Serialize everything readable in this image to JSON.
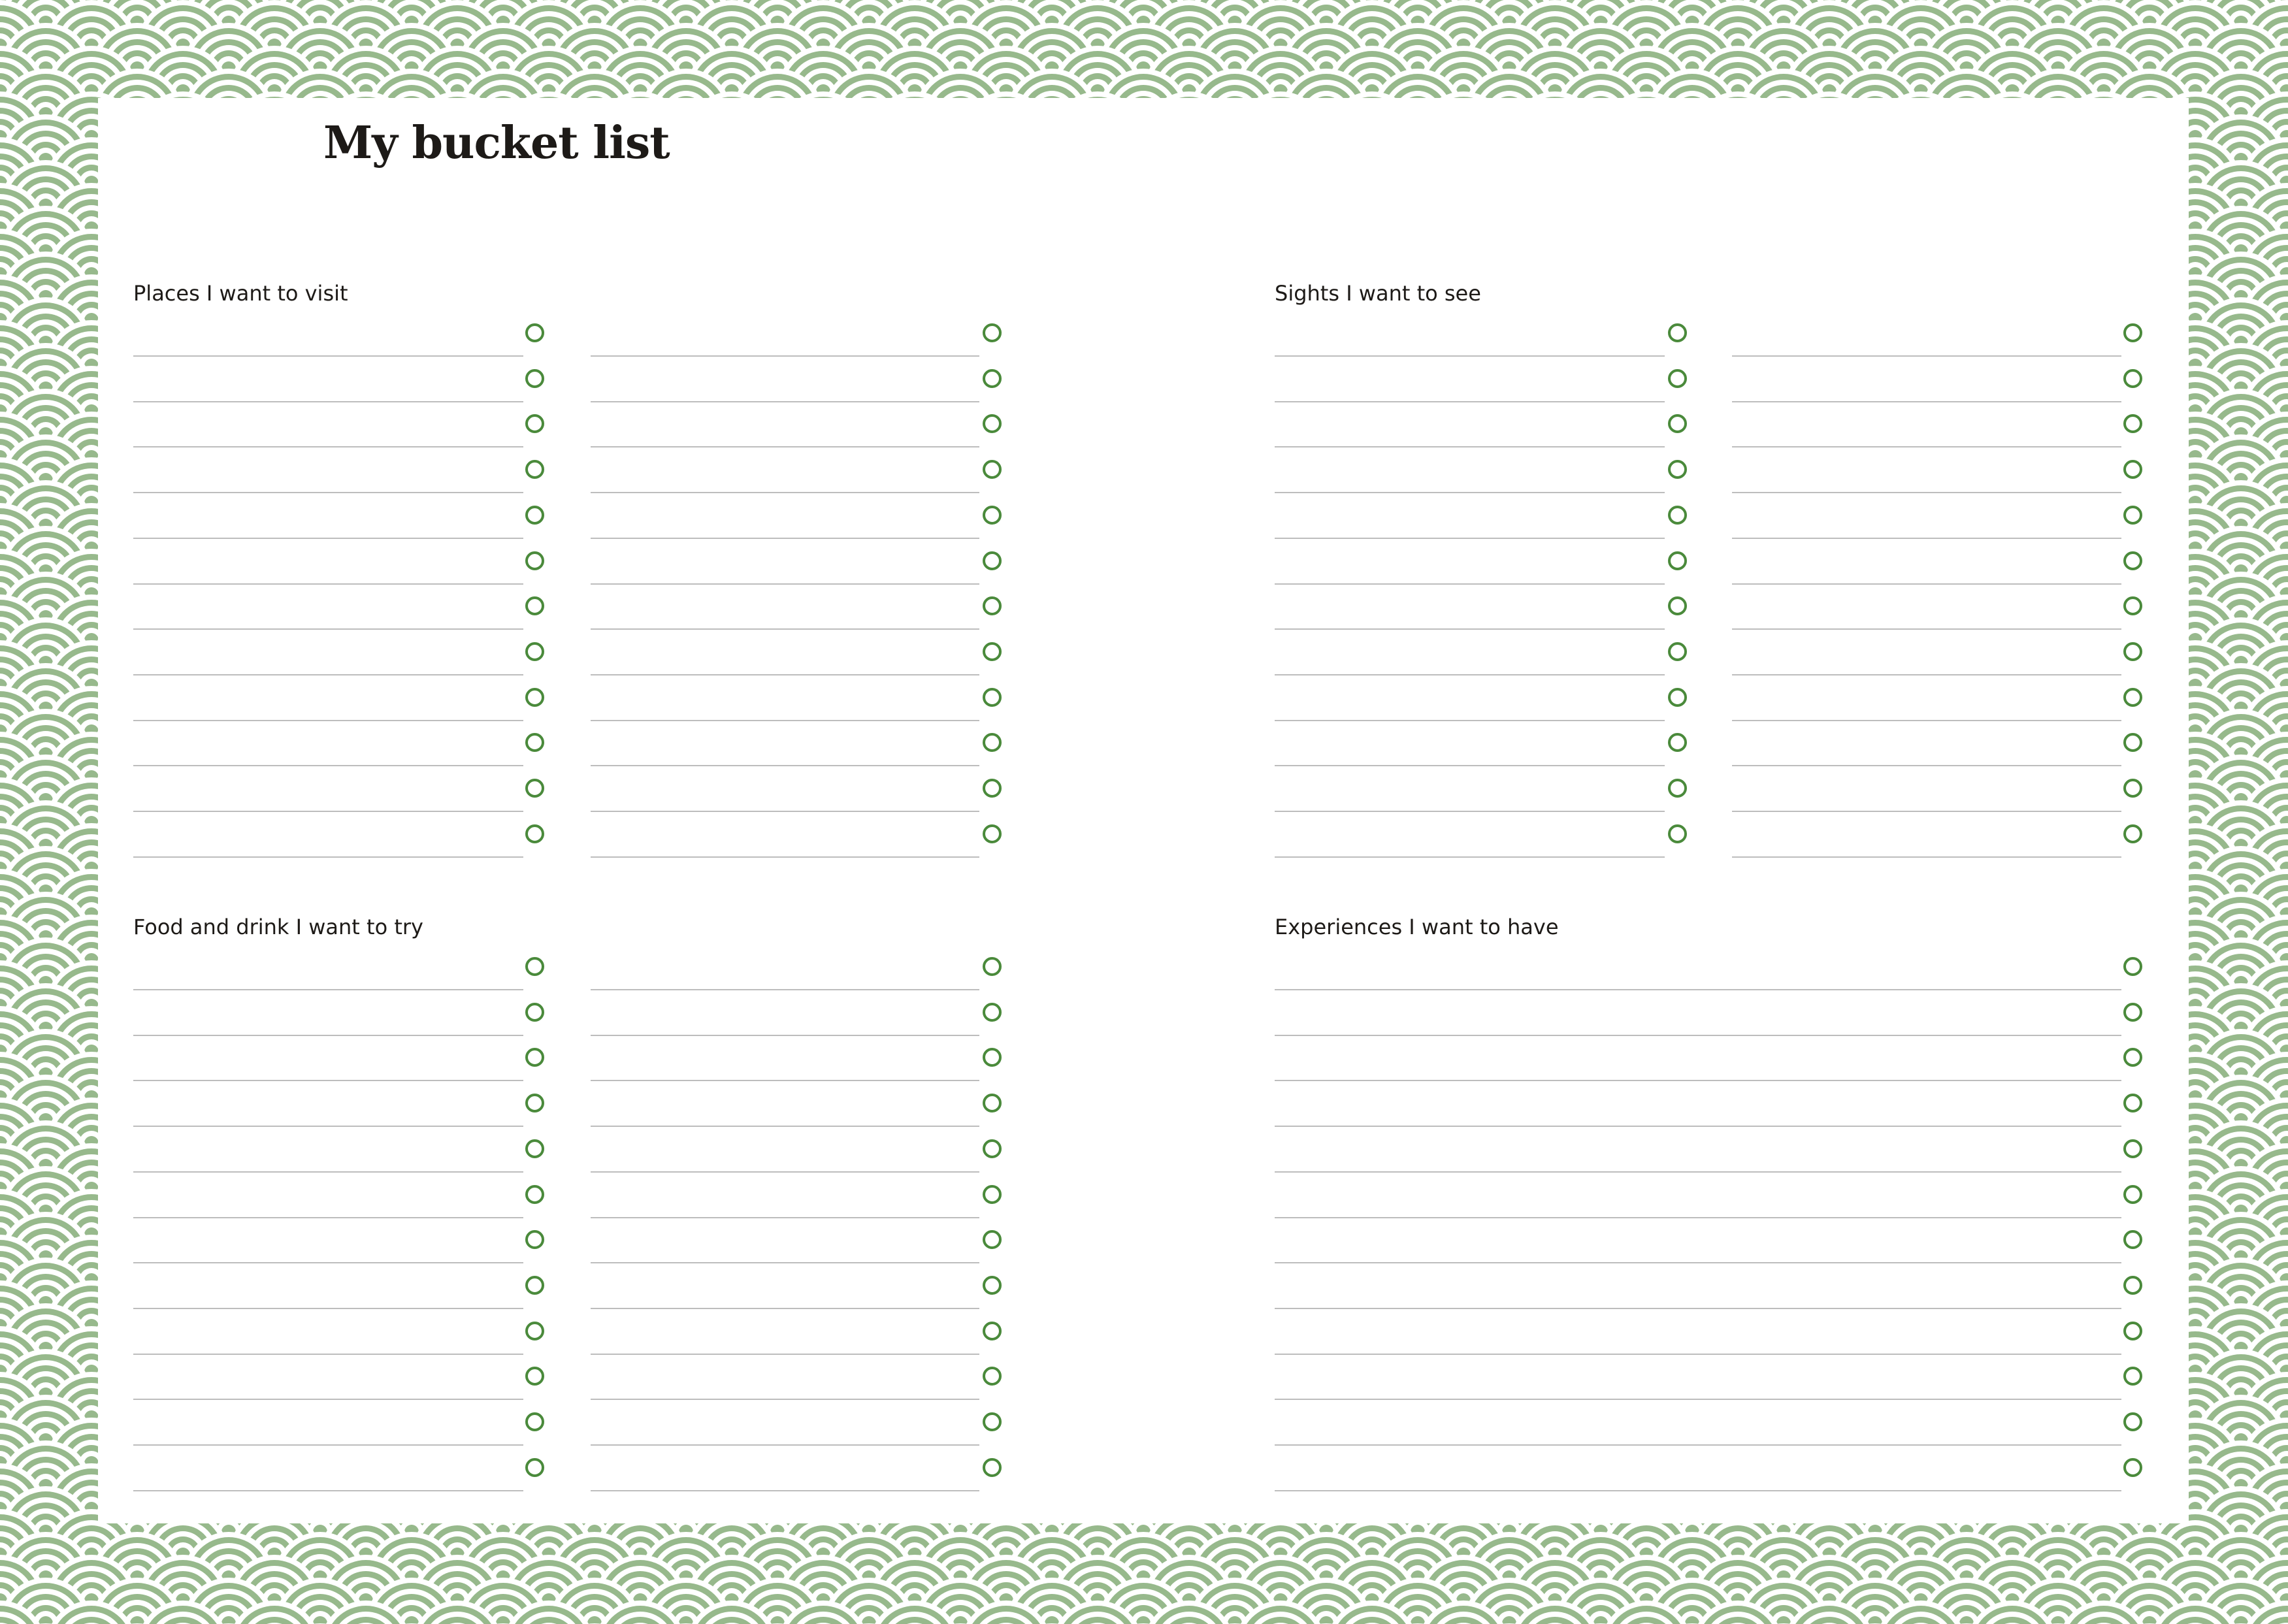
{
  "page": {
    "title": "My bucket list",
    "pattern": "green-seigaiha-wave-pattern",
    "colors": {
      "pattern_green": "#97b98c",
      "pattern_white": "#ffffff",
      "checkbox_green": "#4a8a3b",
      "line_gray": "#bdbdbd",
      "text": "#1d1a17"
    }
  },
  "sections": [
    {
      "id": "places",
      "title": "Places I want to visit",
      "columns": 2,
      "rows_per_column": 12
    },
    {
      "id": "sights",
      "title": "Sights I want to see",
      "columns": 2,
      "rows_per_column": 12
    },
    {
      "id": "food",
      "title": "Food and drink I want to try",
      "columns": 2,
      "rows_per_column": 12
    },
    {
      "id": "experiences",
      "title": "Experiences I want to have",
      "columns": 1,
      "rows_per_column": 12
    }
  ]
}
